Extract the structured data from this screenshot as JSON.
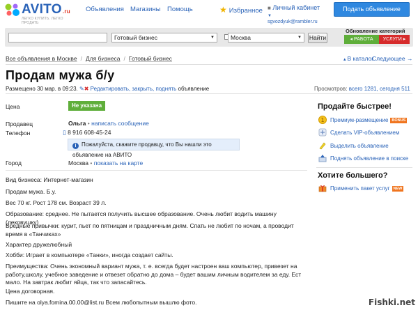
{
  "header": {
    "logo_text": "AVITO",
    "logo_suffix": ".ru",
    "tagline": "ЛЕГКО КУПИТЬ. ЛЕГКО ПРОДАТЬ",
    "nav": [
      "Объявления",
      "Магазины",
      "Помощь"
    ],
    "favorites": "Избранное",
    "cabinet": "Личный кабинет",
    "email": "sgvozdyuk@rambler.ru",
    "post_button": "Подать объявление"
  },
  "search": {
    "query": "",
    "category": "Готовый бизнес",
    "city": "Москва",
    "find_button": "Найти",
    "update_title": "Обновление категорий",
    "work_label": "РАБОТА",
    "services_label": "УСЛУГИ"
  },
  "breadcrumb": [
    "Все объявления в Москве",
    "Для бизнеса",
    "Готовый бизнес"
  ],
  "nav_right": {
    "to_catalog": "В каталог",
    "next": "Следующее →"
  },
  "ad": {
    "title": "Продам мужа б/у",
    "posted": "Размещено 30 мар. в 09:23.",
    "actions": "Редактировать, закрыть, поднять",
    "actions_suffix": "объявление",
    "views_label": "Просмотров:",
    "views_value": "всего 1281, сегодня 511",
    "price_label": "Цена",
    "price_value": "Не указана",
    "seller_label": "Продавец",
    "seller_name": "Ольга",
    "write_message": "написать сообщение",
    "phone_label": "Телефон",
    "phone": "8 916 608-45-24",
    "notice": "Пожалуйста, скажите продавцу, что Вы нашли это объявление на АВИТО",
    "city_label": "Город",
    "city": "Москва",
    "show_map": "показать на карте",
    "business_type": "Вид бизнеса: Интернет-магазин",
    "description": [
      "Продам мужа. Б.у.",
      "Вес 70 кг. Рост 178 см. Возраст 39 л.",
      "Образование: среднее. Не пытается получить высшее образование. Очень любит водить машину (лековушку)",
      "Вредные привычки: курит, пьет по пятницам и праздничным дням. Спать не любит по ночам, а проводит время в «Танчиках»",
      "Характер дружелюбный",
      "Хобби: Играет в компьютере «Танки», иногда создает сайты.",
      "Преимущества: Очень экономный вариант мужа, т. е. всегда будет настроен ваш компьютер, привезет на работу,школу, учебное заведение и отвезет обратно до дома – будет вашим личным водителем за еду. Ест мало. На завтрак любит яйца, так что запасайтесь.",
      "Цена договорная.",
      "Пишите на olya.fomina.00.00@list.ru Всем любопытным вышлю фото."
    ]
  },
  "sidebar": {
    "sell_faster": "Продайте быстрее!",
    "items": [
      {
        "label": "Премиум-размещение",
        "badge": "BONUS"
      },
      {
        "label": "Сделать VIP-объявлением",
        "badge": ""
      },
      {
        "label": "Выделить объявление",
        "badge": ""
      },
      {
        "label": "Поднять объявление в поиске",
        "badge": ""
      }
    ],
    "want_more": "Хотите большего?",
    "package": {
      "label": "Применить пакет услуг",
      "badge": "NEW"
    }
  },
  "watermark": "Fishki.net"
}
